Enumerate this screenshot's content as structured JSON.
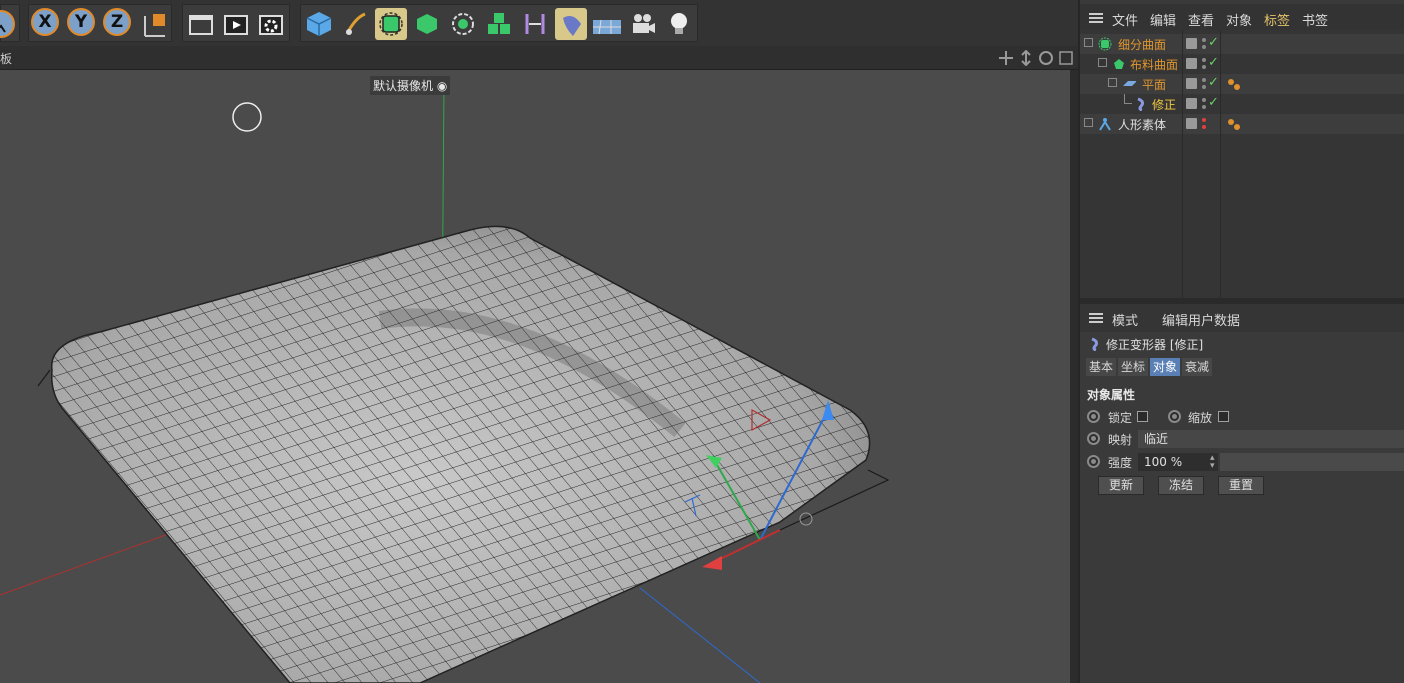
{
  "toolbar": {
    "axis_x": "X",
    "axis_y": "Y",
    "axis_z": "Z"
  },
  "viewport": {
    "header_label": "板",
    "camera_label": "默认摄像机"
  },
  "object_manager": {
    "menu": [
      "文件",
      "编辑",
      "查看",
      "对象",
      "标签",
      "书签"
    ],
    "objects": [
      {
        "name": "细分曲面",
        "icon": "subdivision-surface-icon"
      },
      {
        "name": "布料曲面",
        "icon": "cloth-surface-icon"
      },
      {
        "name": "平面",
        "icon": "plane-icon"
      },
      {
        "name": "修正",
        "icon": "correction-deformer-icon"
      },
      {
        "name": "人形素体",
        "icon": "figure-icon"
      }
    ]
  },
  "attributes": {
    "menu": [
      "模式",
      "编辑",
      "用户数据"
    ],
    "title": "修正变形器 [修正]",
    "tabs": [
      "基本",
      "坐标",
      "对象",
      "衰减"
    ],
    "section": "对象属性",
    "lock_label": "锁定",
    "scale_label": "缩放",
    "mapping_label": "映射",
    "mapping_value": "临近",
    "strength_label": "强度",
    "strength_value": "100 %",
    "buttons": [
      "更新",
      "冻结",
      "重置"
    ]
  },
  "colors": {
    "accent_tab": "#5a7fb4",
    "active_menu": "#e4c46a",
    "object_orange": "#e0952e",
    "selected_yellow": "#f0c840"
  }
}
